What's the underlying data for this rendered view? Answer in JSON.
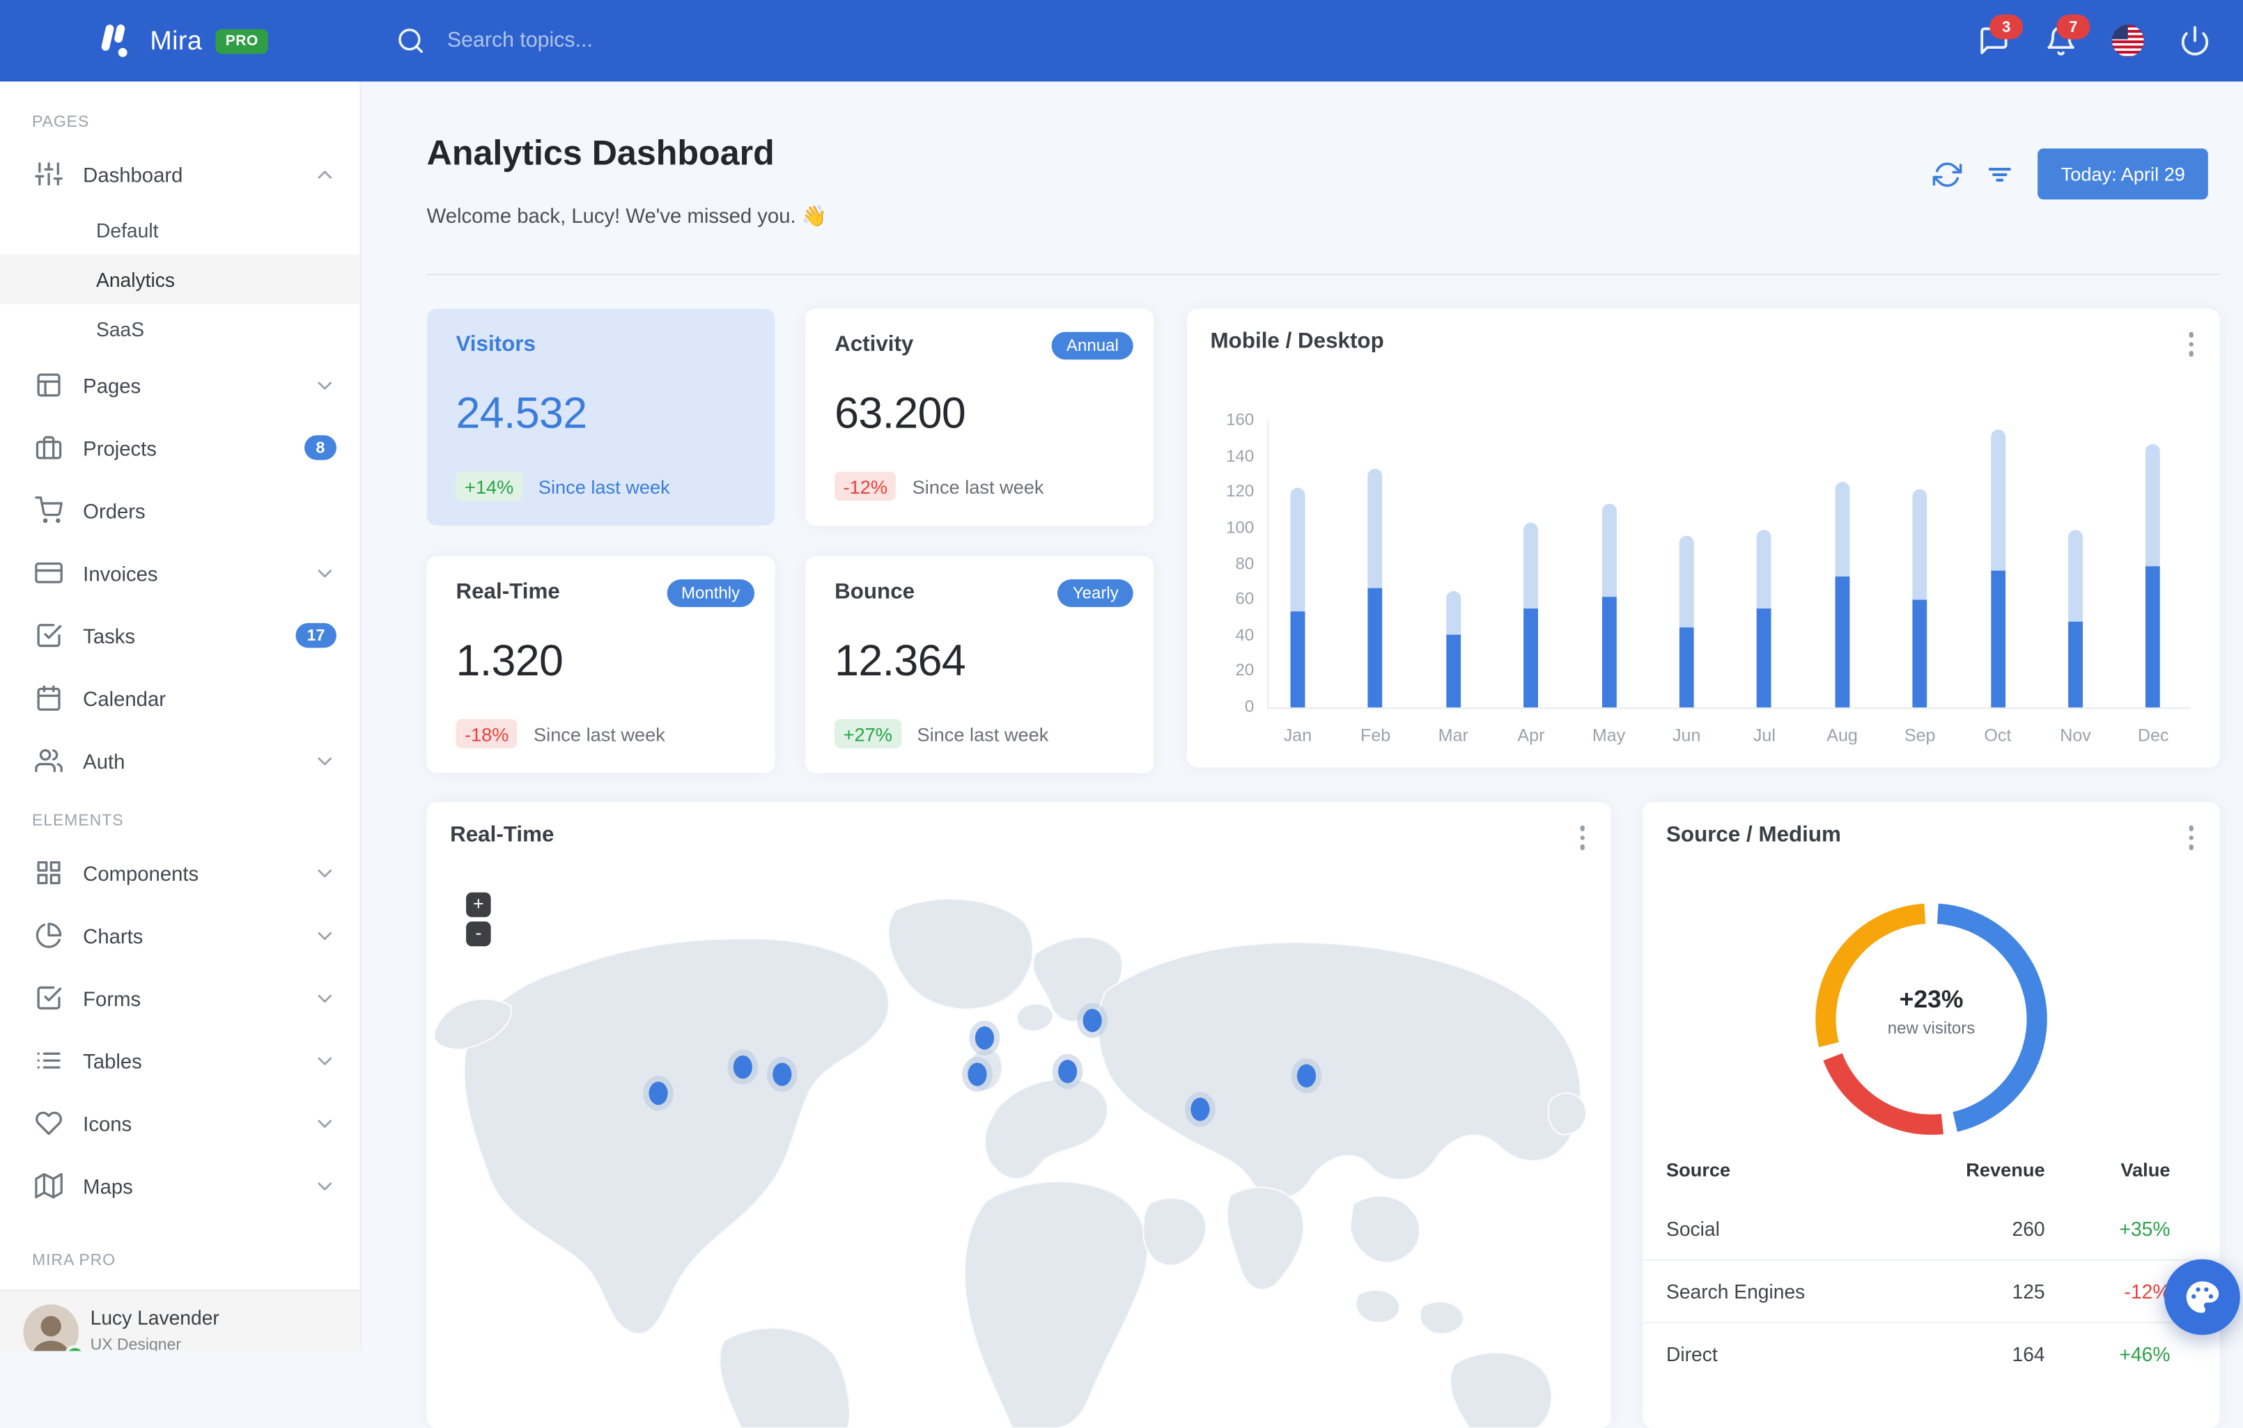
{
  "navbar": {
    "brand": "Mira",
    "brand_badge": "PRO",
    "search_placeholder": "Search topics...",
    "messages_count": "3",
    "notifications_count": "7"
  },
  "sidebar": {
    "sections": [
      {
        "label": "PAGES",
        "items": [
          {
            "label": "Dashboard",
            "icon": "sliders-icon",
            "chevron": "up"
          },
          {
            "label": "Default",
            "child": true
          },
          {
            "label": "Analytics",
            "child": true,
            "active": true
          },
          {
            "label": "SaaS",
            "child": true
          },
          {
            "label": "Pages",
            "icon": "layout-icon",
            "chevron": "down"
          },
          {
            "label": "Projects",
            "icon": "briefcase-icon",
            "badge": "8"
          },
          {
            "label": "Orders",
            "icon": "cart-icon"
          },
          {
            "label": "Invoices",
            "icon": "credit-card-icon",
            "chevron": "down"
          },
          {
            "label": "Tasks",
            "icon": "check-square-icon",
            "badge": "17"
          },
          {
            "label": "Calendar",
            "icon": "calendar-icon"
          },
          {
            "label": "Auth",
            "icon": "users-icon",
            "chevron": "down"
          }
        ]
      },
      {
        "label": "ELEMENTS",
        "items": [
          {
            "label": "Components",
            "icon": "grid-icon",
            "chevron": "down"
          },
          {
            "label": "Charts",
            "icon": "pie-chart-icon",
            "chevron": "down"
          },
          {
            "label": "Forms",
            "icon": "check-square-icon",
            "chevron": "down"
          },
          {
            "label": "Tables",
            "icon": "list-icon",
            "chevron": "down"
          },
          {
            "label": "Icons",
            "icon": "heart-icon",
            "chevron": "down"
          },
          {
            "label": "Maps",
            "icon": "map-icon",
            "chevron": "down"
          }
        ]
      },
      {
        "label": "MIRA PRO",
        "items": []
      }
    ],
    "user": {
      "name": "Lucy Lavender",
      "role": "UX Designer"
    }
  },
  "header": {
    "title": "Analytics Dashboard",
    "subtitle": "Welcome back, Lucy! We've missed you. 👋",
    "date_button": "Today: April 29"
  },
  "stats": [
    {
      "title": "Visitors",
      "value": "24.532",
      "delta": "+14%",
      "delta_dir": "up",
      "note": "Since last week",
      "highlight": true
    },
    {
      "title": "Activity",
      "value": "63.200",
      "delta": "-12%",
      "delta_dir": "down",
      "note": "Since last week",
      "badge": "Annual"
    },
    {
      "title": "Real-Time",
      "value": "1.320",
      "delta": "-18%",
      "delta_dir": "down",
      "note": "Since last week",
      "badge": "Monthly"
    },
    {
      "title": "Bounce",
      "value": "12.364",
      "delta": "+27%",
      "delta_dir": "up",
      "note": "Since last week",
      "badge": "Yearly"
    }
  ],
  "chart_data": [
    {
      "type": "bar",
      "title": "Mobile / Desktop",
      "stacked": true,
      "categories": [
        "Jan",
        "Feb",
        "Mar",
        "Apr",
        "May",
        "Jun",
        "Jul",
        "Aug",
        "Sep",
        "Oct",
        "Nov",
        "Dec"
      ],
      "series": [
        {
          "name": "Mobile",
          "color": "#3E7CDF",
          "values": [
            54,
            67,
            41,
            55,
            62,
            45,
            55,
            73,
            60,
            76,
            48,
            79
          ]
        },
        {
          "name": "Desktop",
          "color": "#C8DBF4",
          "values": [
            69,
            66,
            24,
            48,
            52,
            51,
            44,
            53,
            62,
            79,
            51,
            68
          ]
        }
      ],
      "ylim": [
        0,
        160
      ],
      "yticks": [
        0,
        20,
        40,
        60,
        80,
        100,
        120,
        140,
        160
      ],
      "grid": false,
      "legend": "none"
    },
    {
      "type": "donut",
      "title": "Source / Medium",
      "labels": [
        "Social",
        "Search Engines",
        "Direct"
      ],
      "values": [
        260,
        125,
        164
      ],
      "colors": [
        "#4285E2",
        "#E8473F",
        "#F6A50B"
      ],
      "center_value": "+23%",
      "center_label": "new visitors"
    }
  ],
  "map": {
    "title": "Real-Time",
    "zoom_in": "+",
    "zoom_out": "-",
    "markers": [
      [
        19.6,
        41.3
      ],
      [
        26.7,
        36.7
      ],
      [
        30.0,
        38.0
      ],
      [
        47.1,
        31.6
      ],
      [
        46.5,
        38.0
      ],
      [
        56.2,
        28.6
      ],
      [
        54.1,
        37.5
      ],
      [
        65.3,
        44.1
      ],
      [
        74.3,
        38.3
      ]
    ]
  },
  "source_medium": {
    "title": "Source / Medium",
    "table": {
      "headers": [
        "Source",
        "Revenue",
        "Value"
      ],
      "rows": [
        {
          "source": "Social",
          "revenue": "260",
          "value": "+35%",
          "dir": "up"
        },
        {
          "source": "Search Engines",
          "revenue": "125",
          "value": "-12%",
          "dir": "down"
        },
        {
          "source": "Direct",
          "revenue": "164",
          "value": "+46%",
          "dir": "up"
        }
      ]
    }
  },
  "colors": {
    "navbar": "#2D62CE",
    "primary": "#3B7DDD",
    "success": "#28A348",
    "danger": "#E8413C",
    "highlight_card": "#DCE8F9"
  }
}
